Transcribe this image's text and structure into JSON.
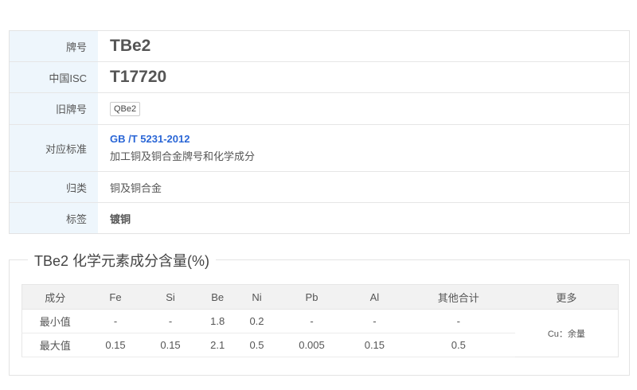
{
  "info": {
    "rows": [
      {
        "label": "牌号",
        "value": "TBe2"
      },
      {
        "label": "中国ISC",
        "value": "T17720"
      },
      {
        "label": "旧牌号",
        "value": "QBe2"
      },
      {
        "label": "对应标准",
        "link": "GB /T 5231-2012",
        "desc": "加工铜及铜合金牌号和化学成分"
      },
      {
        "label": "归类",
        "value": "铜及铜合金"
      },
      {
        "label": "标签",
        "value": "镀铜"
      }
    ]
  },
  "composition": {
    "title": "TBe2 化学元素成分含量(%)",
    "headers": [
      "成分",
      "Fe",
      "Si",
      "Be",
      "Ni",
      "Pb",
      "Al",
      "其他合计",
      "更多"
    ],
    "rows": [
      {
        "label": "最小值",
        "values": [
          "-",
          "-",
          "1.8",
          "0.2",
          "-",
          "-",
          "-"
        ]
      },
      {
        "label": "最大值",
        "values": [
          "0.15",
          "0.15",
          "2.1",
          "0.5",
          "0.005",
          "0.15",
          "0.5"
        ]
      }
    ],
    "more": "Cu：余量"
  },
  "colors": {
    "link": "#2a66d6",
    "label_bg": "#eef6fc",
    "header_bg": "#f2f2f2"
  }
}
